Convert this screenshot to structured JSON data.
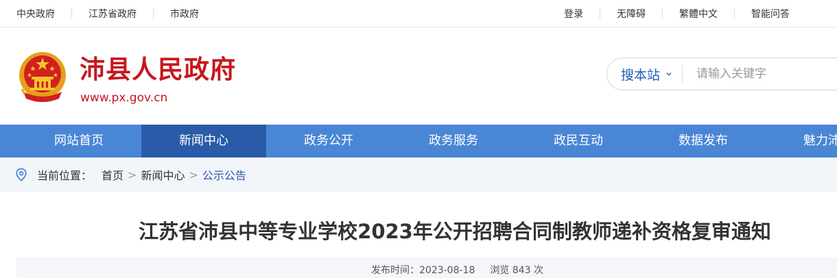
{
  "topbar": {
    "left_links": [
      "中央政府",
      "江苏省政府",
      "市政府"
    ],
    "right_links": [
      "登录",
      "无障碍",
      "繁體中文",
      "智能问答"
    ]
  },
  "header": {
    "site_title": "沛县人民政府",
    "site_url": "www.px.gov.cn",
    "search_scope": "搜本站",
    "search_placeholder": "请输入关键字"
  },
  "nav": {
    "items": [
      "网站首页",
      "新闻中心",
      "政务公开",
      "政务服务",
      "政民互动",
      "数据发布",
      "魅力沛县"
    ],
    "active": "新闻中心"
  },
  "breadcrumb": {
    "label": "当前位置：",
    "home": "首页",
    "arrow": ">",
    "section": "新闻中心",
    "current": "公示公告"
  },
  "article": {
    "title": "江苏省沛县中等专业学校2023年公开招聘合同制教师递补资格复审通知",
    "publish_label": "发布时间：",
    "publish_date": "2023-08-18",
    "views_label": "浏览",
    "views_count": "843",
    "views_unit": "次"
  },
  "colors": {
    "brand_red": "#c8161d",
    "nav_blue": "#4a86d6",
    "nav_active": "#2a5ba8",
    "link_blue": "#1e5fb9"
  }
}
